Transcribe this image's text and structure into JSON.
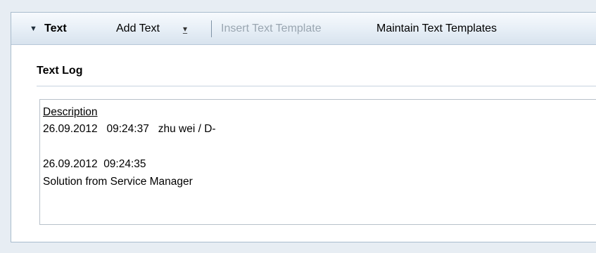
{
  "toolbar": {
    "section_title": "Text",
    "add_text_label": "Add Text",
    "insert_template_label": "Insert Text Template",
    "maintain_templates_label": "Maintain Text Templates"
  },
  "content": {
    "title": "Text Log",
    "log": {
      "heading": "Description",
      "lines": [
        "26.09.2012   09:24:37   zhu wei / D-",
        "",
        "26.09.2012  09:24:35",
        "Solution from Service Manager"
      ]
    }
  },
  "icons": {
    "collapse": "triangle-down-icon",
    "add_text_dropdown": "dropdown-arrow-icon"
  },
  "colors": {
    "disabled_text": "#9aa6b1",
    "panel_border": "#a9bccd"
  }
}
